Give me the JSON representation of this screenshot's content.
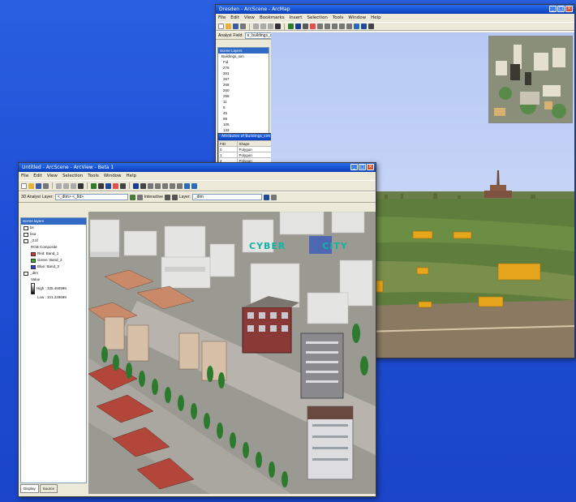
{
  "scene_window": {
    "title": "Dresden - ArcScene - ArcMap",
    "menu": [
      "File",
      "Edit",
      "View",
      "Bookmarks",
      "Insert",
      "Selection",
      "Tools",
      "Window",
      "Help"
    ],
    "toolbar2_label": "Analyst",
    "toolbar2_field": "Field:",
    "layer_combo": "e_buildings_dem_dxf_floors",
    "toc_header": "Scene Layers",
    "toc_items": [
      "Buildings_sim",
      "Fid",
      "276",
      "261",
      "267",
      "268",
      "260",
      "258",
      "11",
      "8",
      "45",
      "99",
      "105",
      "133",
      "148",
      "150"
    ],
    "attr_table": {
      "title": "Attributes of Buildings_sim",
      "headers": [
        "FID",
        "Shape",
        "Id"
      ],
      "rows": [
        [
          "0",
          "Polygon",
          "0"
        ],
        [
          "1",
          "Polygon",
          "0"
        ],
        [
          "2",
          "Polygon",
          "0"
        ]
      ]
    }
  },
  "front_window": {
    "title": "Untitled - ArcScene - ArcView - Beta 1",
    "menu": [
      "File",
      "Edit",
      "View",
      "Selection",
      "Tools",
      "Window",
      "Help"
    ],
    "toolbar_label": "3D Analyst",
    "layer_label": "Layer:",
    "layer_value": "<_dtm> <_fid>",
    "interactive_label": "Interactive",
    "layer2_label": "Layer:",
    "layer2_value": "_dtm",
    "toc_header": "Scene layers",
    "toc_items": [
      {
        "label": "bs",
        "kind": "layer"
      },
      {
        "label": "bsa",
        "kind": "layer"
      },
      {
        "label": "_0.tif",
        "kind": "layer"
      },
      {
        "label": "RGB Composite",
        "kind": "text"
      },
      {
        "label": "Red: Band_1",
        "kind": "band",
        "color": "#e03030"
      },
      {
        "label": "Green: Band_2",
        "kind": "band",
        "color": "#30b030"
      },
      {
        "label": "Blue: Band_3",
        "kind": "band",
        "color": "#3040e0"
      },
      {
        "label": "_dtm",
        "kind": "layer"
      },
      {
        "label": "Value",
        "kind": "text"
      },
      {
        "label": "High : 335.460999",
        "kind": "ramp-high"
      },
      {
        "label": "Low : 101.229699",
        "kind": "ramp-low"
      }
    ],
    "tabs": [
      "Display",
      "Source"
    ],
    "logo_text_left": "CYBER",
    "logo_text_right": "CITY"
  }
}
